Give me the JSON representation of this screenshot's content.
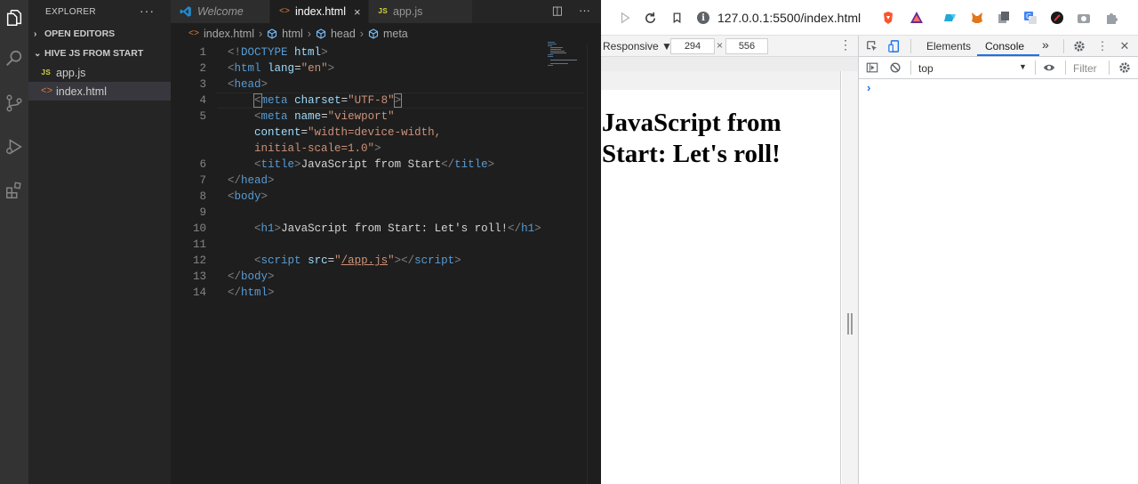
{
  "vscode": {
    "explorer": {
      "title": "EXPLORER",
      "more": "···",
      "open_editors": "OPEN EDITORS",
      "folder": "HIVE JS FROM START",
      "files": [
        {
          "icon": "JS",
          "name": "app.js"
        },
        {
          "icon": "<>",
          "name": "index.html"
        }
      ]
    },
    "tabs": [
      {
        "label": "Welcome"
      },
      {
        "label": "index.html",
        "close": "×"
      },
      {
        "label": "app.js",
        "icon": "JS"
      }
    ],
    "tab_actions": {
      "split": "◫",
      "more": "···"
    },
    "breadcrumb": [
      "index.html",
      "html",
      "head",
      "meta"
    ],
    "line_numbers": [
      "1",
      "2",
      "3",
      "4",
      "5",
      "",
      "",
      "6",
      "7",
      "8",
      "9",
      "10",
      "11",
      "12",
      "13",
      "14"
    ]
  },
  "browser": {
    "url": "127.0.0.1:5500/index.html",
    "device_mode": {
      "label": "Responsive ▼",
      "width": "294",
      "x": "×",
      "height": "556",
      "more": "⋮"
    },
    "page_heading": "JavaScript from Start: Let's roll!",
    "devtools": {
      "tabs": [
        "Elements",
        "Console"
      ],
      "overflow": "»",
      "context": "top",
      "context_arrow": "▼",
      "filter_placeholder": "Filter",
      "prompt": "›"
    }
  },
  "colors": {
    "vscode_bg": "#1e1e1e",
    "activity_bar": "#333333",
    "sidebar": "#252526",
    "tag": "#569cd6",
    "attr": "#9cdcfe",
    "string": "#ce9178",
    "devtools_accent": "#1a73e8"
  }
}
